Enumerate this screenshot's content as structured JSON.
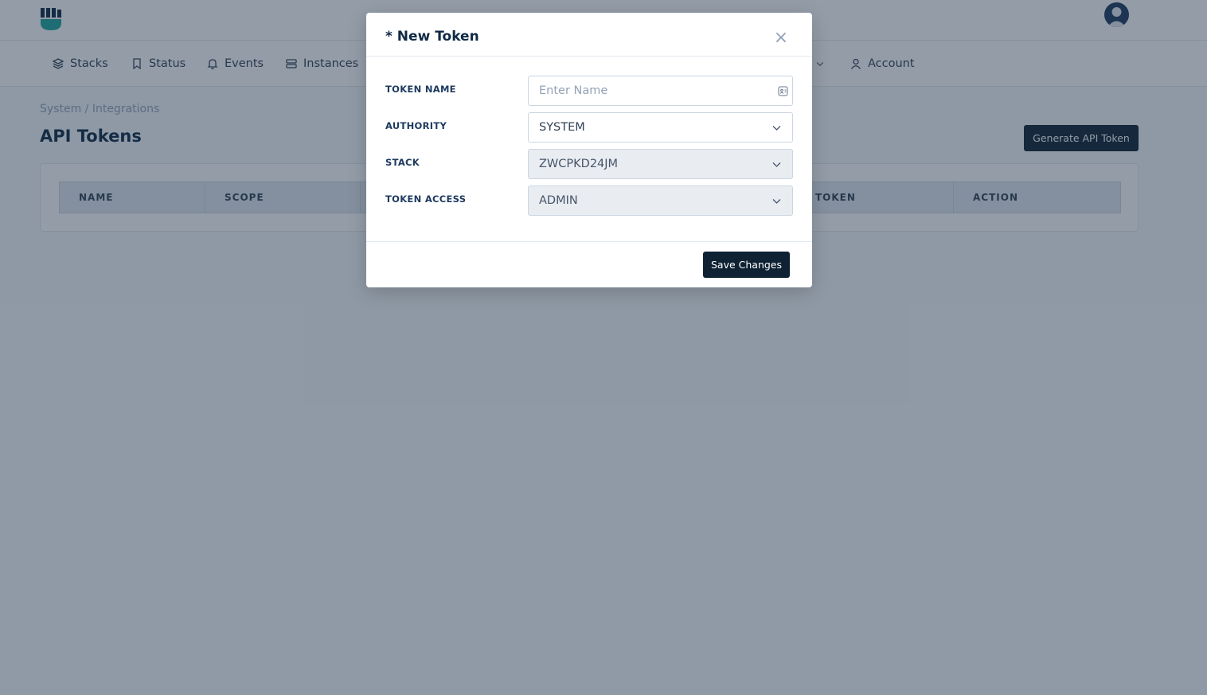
{
  "nav": {
    "items": [
      {
        "label": "Stacks",
        "icon": "layers-icon"
      },
      {
        "label": "Status",
        "icon": "bookmark-icon"
      },
      {
        "label": "Events",
        "icon": "bell-icon"
      },
      {
        "label": "Instances",
        "icon": "server-icon"
      },
      {
        "label": "Account",
        "icon": "user-icon"
      }
    ]
  },
  "page": {
    "breadcrumb": "System / Integrations",
    "title": "API Tokens",
    "generate_button": "Generate API Token",
    "table_headers": [
      "NAME",
      "SCOPE",
      "TOKEN",
      "ACTION"
    ]
  },
  "modal": {
    "title": "* New Token",
    "close_label": "×",
    "fields": {
      "token_name": {
        "label": "TOKEN NAME",
        "placeholder": "Enter Name",
        "value": ""
      },
      "authority": {
        "label": "AUTHORITY",
        "value": "SYSTEM"
      },
      "stack": {
        "label": "STACK",
        "value": "ZWCPKD24JM"
      },
      "token_access": {
        "label": "TOKEN ACCESS",
        "value": "ADMIN"
      }
    },
    "save_button": "Save Changes"
  },
  "colors": {
    "brand": "#1fa59a",
    "primary_button": "#0f2233"
  }
}
